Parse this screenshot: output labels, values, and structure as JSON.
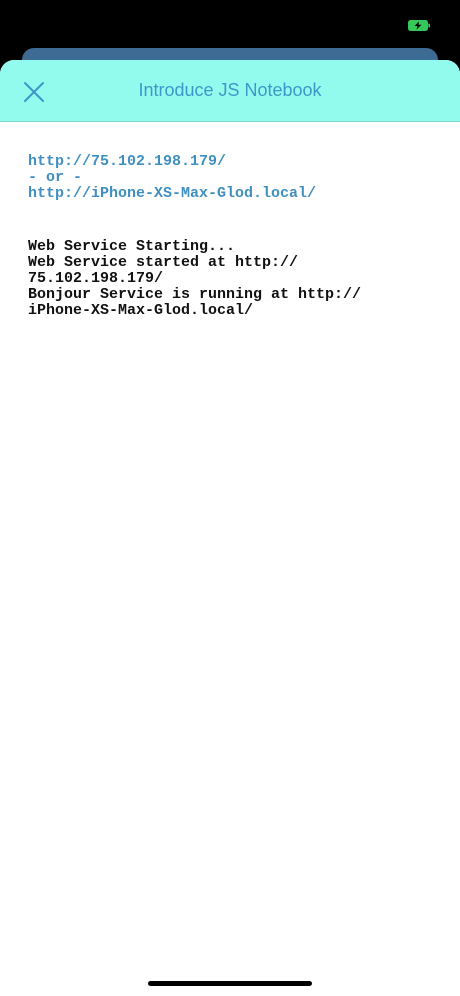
{
  "status_bar": {
    "battery_icon": "battery-charging-icon",
    "battery_color": "#34c759"
  },
  "nav": {
    "title": "Introduce JS Notebook",
    "close_icon": "close-icon"
  },
  "links": {
    "ip_url": "http://75.102.198.179/",
    "separator": "- or -",
    "local_url": "http://iPhone-XS-Max-Glod.local/"
  },
  "log": {
    "lines": [
      "Web Service Starting...",
      "Web Service started at http://",
      "75.102.198.179/",
      "Bonjour Service is running at http://",
      "iPhone-XS-Max-Glod.local/"
    ]
  },
  "colors": {
    "nav_background": "#93fbed",
    "accent": "#3f97c8",
    "background_card": "#3d6b94"
  }
}
